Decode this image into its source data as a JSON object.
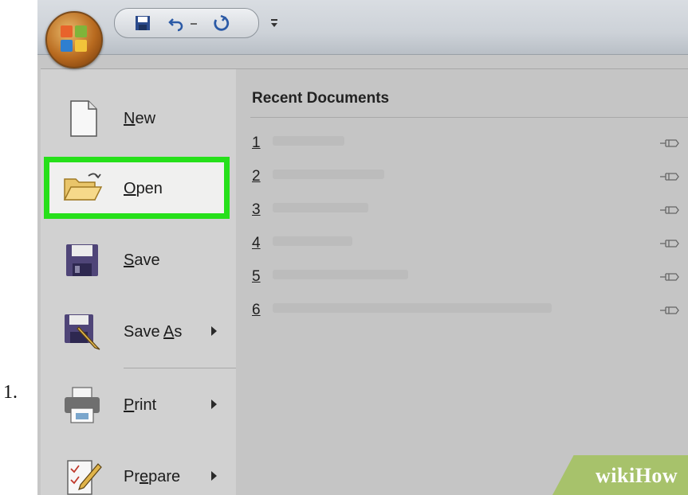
{
  "step_number": "1.",
  "menu": {
    "items": [
      {
        "name": "new",
        "pre": "",
        "key": "N",
        "post": "ew",
        "has_submenu": false
      },
      {
        "name": "open",
        "pre": "",
        "key": "O",
        "post": "pen",
        "has_submenu": false,
        "highlighted": true
      },
      {
        "name": "save",
        "pre": "",
        "key": "S",
        "post": "ave",
        "has_submenu": false
      },
      {
        "name": "save-as",
        "pre": "Save ",
        "key": "A",
        "post": "s",
        "has_submenu": true
      },
      {
        "name": "print",
        "pre": "",
        "key": "P",
        "post": "rint",
        "has_submenu": true
      },
      {
        "name": "prepare",
        "pre": "Pr",
        "key": "e",
        "post": "pare",
        "has_submenu": true
      }
    ]
  },
  "recent": {
    "title": "Recent Documents",
    "rows": [
      "1",
      "2",
      "3",
      "4",
      "5",
      "6"
    ]
  },
  "watermark": {
    "wiki": "wiki",
    "how": "How"
  },
  "colors": {
    "highlight": "#26e01a"
  }
}
